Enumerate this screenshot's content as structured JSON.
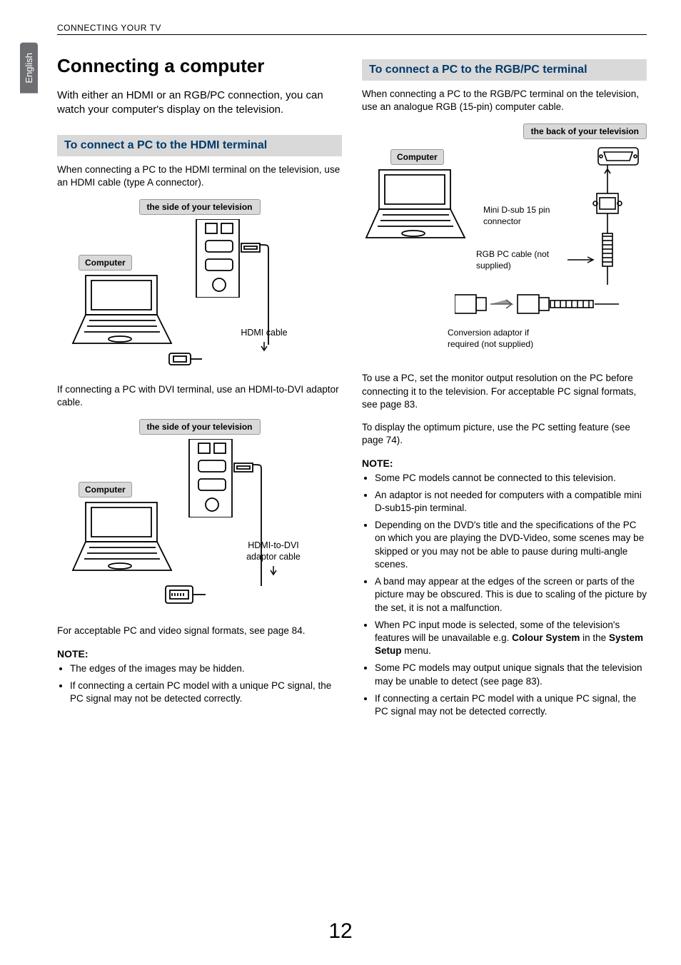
{
  "running_head": "CONNECTING YOUR TV",
  "lang_tab": "English",
  "page_number": "12",
  "left": {
    "h1": "Connecting a computer",
    "intro": "With either an HDMI or an RGB/PC connection, you can watch your computer's display on the television.",
    "section1": {
      "title": "To connect a PC to the HDMI terminal",
      "body": "When connecting a PC to the HDMI terminal on the television, use an HDMI cable (type A connector).",
      "diagram_top_label": "the side of your television",
      "computer_label": "Computer",
      "cable_label": "HDMI cable"
    },
    "section1b": {
      "body": "If connecting a PC with DVI terminal, use an HDMI-to-DVI adaptor cable.",
      "diagram_top_label": "the side of your television",
      "computer_label": "Computer",
      "cable_label": "HDMI-to-DVI adaptor cable"
    },
    "after_diagrams": "For acceptable PC and video signal formats, see page 84.",
    "note_head": "NOTE:",
    "notes": [
      "The edges of the images may be hidden.",
      "If connecting a certain PC model with a unique PC signal, the PC signal may not be detected correctly."
    ]
  },
  "right": {
    "section_title": "To connect a PC to the RGB/PC terminal",
    "body": "When connecting a PC to the RGB/PC terminal on the television, use an analogue RGB (15-pin) computer cable.",
    "diagram_top_label": "the back of your television",
    "computer_label": "Computer",
    "labels": {
      "mini_dsub": "Mini D-sub 15 pin connector",
      "rgb_cable": "RGB PC cable (not supplied)",
      "adaptor": "Conversion adaptor if required (not supplied)"
    },
    "para1": "To use a PC, set the monitor output resolution on the PC before connecting it to the television. For acceptable PC signal formats, see page 83.",
    "para2": "To display the optimum picture, use the PC setting feature (see page 74).",
    "note_head": "NOTE:",
    "notes": [
      "Some PC models cannot be connected to this television.",
      "An adaptor is not needed for computers with a compatible mini D-sub15-pin terminal.",
      "Depending on the DVD's title and the specifications of the PC on which you are playing the DVD-Video, some scenes may be skipped or you may not be able to pause during multi-angle scenes.",
      "A band may appear at the edges of the screen or parts of the picture may be obscured. This is due to scaling of the picture by the set, it is not a malfunction.",
      "When PC input mode is selected, some of the television's features will be unavailable e.g. <b>Colour System</b> in the <b>System Setup</b> menu.",
      "Some PC models may output unique signals that the television may be unable to detect (see page 83).",
      "If connecting a certain PC model with a unique PC signal, the PC signal may not be detected correctly."
    ]
  }
}
